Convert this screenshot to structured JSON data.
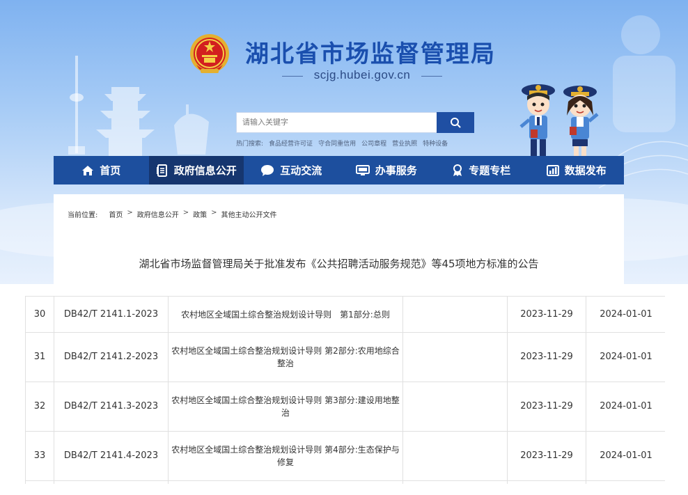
{
  "header": {
    "site_title": "湖北省市场监督管理局",
    "domain": "scjg.hubei.gov.cn",
    "emblem_icon": "national-emblem-icon"
  },
  "search": {
    "placeholder": "请输入关键字",
    "hot_label": "热门搜索:",
    "hot_keywords": [
      "食品经营许可证",
      "守合同重信用",
      "公司章程",
      "营业执照",
      "特种设备"
    ]
  },
  "nav": {
    "items": [
      {
        "label": "首页",
        "icon": "home-icon"
      },
      {
        "label": "政府信息公开",
        "icon": "document-list-icon",
        "active": true
      },
      {
        "label": "互动交流",
        "icon": "chat-bubble-icon"
      },
      {
        "label": "办事服务",
        "icon": "monitor-icon"
      },
      {
        "label": "专题专栏",
        "icon": "ribbon-medal-icon"
      },
      {
        "label": "数据发布",
        "icon": "bar-chart-icon"
      }
    ]
  },
  "breadcrumb": {
    "prefix": "当前位置:",
    "items": [
      "首页",
      "政府信息公开",
      "政策",
      "其他主动公开文件"
    ],
    "separator": ">"
  },
  "article": {
    "title": "湖北省市场监督管理局关于批准发布《公共招聘活动服务规范》等45项地方标准的公告"
  },
  "table": {
    "rows": [
      [
        "30",
        "DB42/T 2141.1-2023",
        "农村地区全域国土综合整治规划设计导则　第1部分:总则",
        "",
        "2023-11-29",
        "2024-01-01"
      ],
      [
        "31",
        "DB42/T 2141.2-2023",
        "农村地区全域国土综合整治规划设计导则 第2部分:农用地综合整治",
        "",
        "2023-11-29",
        "2024-01-01"
      ],
      [
        "32",
        "DB42/T 2141.3-2023",
        "农村地区全域国土综合整治规划设计导则 第3部分:建设用地整治",
        "",
        "2023-11-29",
        "2024-01-01"
      ],
      [
        "33",
        "DB42/T 2141.4-2023",
        "农村地区全域国土综合整治规划设计导则 第4部分:生态保护与修复",
        "",
        "2023-11-29",
        "2024-01-01"
      ]
    ]
  },
  "colors": {
    "nav_bg": "#1d4f9e",
    "nav_active": "#16366f",
    "title_blue": "#1a4fae"
  }
}
